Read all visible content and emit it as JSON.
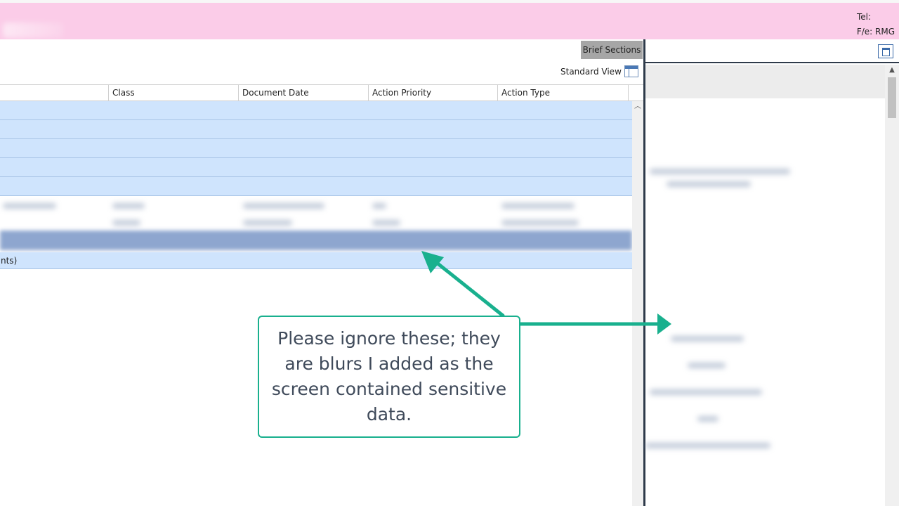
{
  "header": {
    "tel_label": "Tel:",
    "fe_label": "F/e: RMG",
    "accent_color": "#fbcce8"
  },
  "toolbar": {
    "brief_sections_label": "Brief Sections",
    "standard_view_label": "Standard View",
    "standard_view_icon": "layout-icon"
  },
  "grid": {
    "columns": [
      "Class",
      "Document Date",
      "Action Priority",
      "Action Type"
    ],
    "footer_text": "nts)",
    "row_color": "#cfe4fd"
  },
  "right_pane": {
    "restore_icon": "restore-window-icon"
  },
  "callout": {
    "text": "Please ignore these; they are blurs I added as the screen contained sensitive data.",
    "accent_color": "#19b08e"
  }
}
